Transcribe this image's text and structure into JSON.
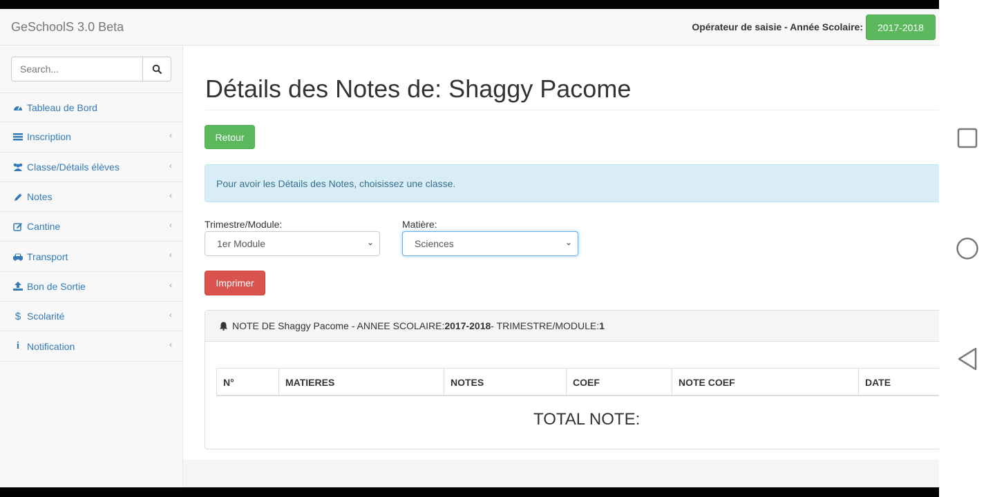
{
  "app": {
    "brand": "GeSchoolS 3.0 Beta",
    "operator_label": "Opérateur de saisie - Année Scolaire:",
    "year": "2017-2018"
  },
  "sidebar": {
    "search_placeholder": "Search...",
    "items": [
      {
        "label": "Tableau de Bord",
        "icon": "dashboard-icon"
      },
      {
        "label": "Inscription",
        "icon": "list-icon"
      },
      {
        "label": "Classe/Détails élèves",
        "icon": "users-icon"
      },
      {
        "label": "Notes",
        "icon": "pencil-icon"
      },
      {
        "label": "Cantine",
        "icon": "edit-icon"
      },
      {
        "label": "Transport",
        "icon": "car-icon"
      },
      {
        "label": "Bon de Sortie",
        "icon": "upload-icon"
      },
      {
        "label": "Scolarité",
        "icon": "dollar-icon"
      },
      {
        "label": "Notification",
        "icon": "info-icon"
      }
    ]
  },
  "main": {
    "title": "Détails des Notes de: Shaggy Pacome",
    "back_button": "Retour",
    "alert": "Pour avoir les Détails des Notes, choisissez une classe.",
    "term_label": "Trimestre/Module:",
    "term_value": "1er Module",
    "subject_label": "Matière:",
    "subject_value": "Sciences",
    "print_button": "Imprimer",
    "panel": {
      "prefix": "NOTE DE Shaggy Pacome - ANNEE SCOLAIRE: ",
      "year": "2017-2018",
      "mid": " - TRIMESTRE/MODULE: ",
      "term": "1"
    },
    "table_headers": [
      "N°",
      "MATIERES",
      "NOTES",
      "COEF",
      "NOTE COEF",
      "DATE"
    ],
    "total_label": "TOTAL NOTE:"
  },
  "colors": {
    "success": "#5cb85c",
    "danger": "#d9534f",
    "link": "#337ab7",
    "info_bg": "#d9edf7"
  }
}
